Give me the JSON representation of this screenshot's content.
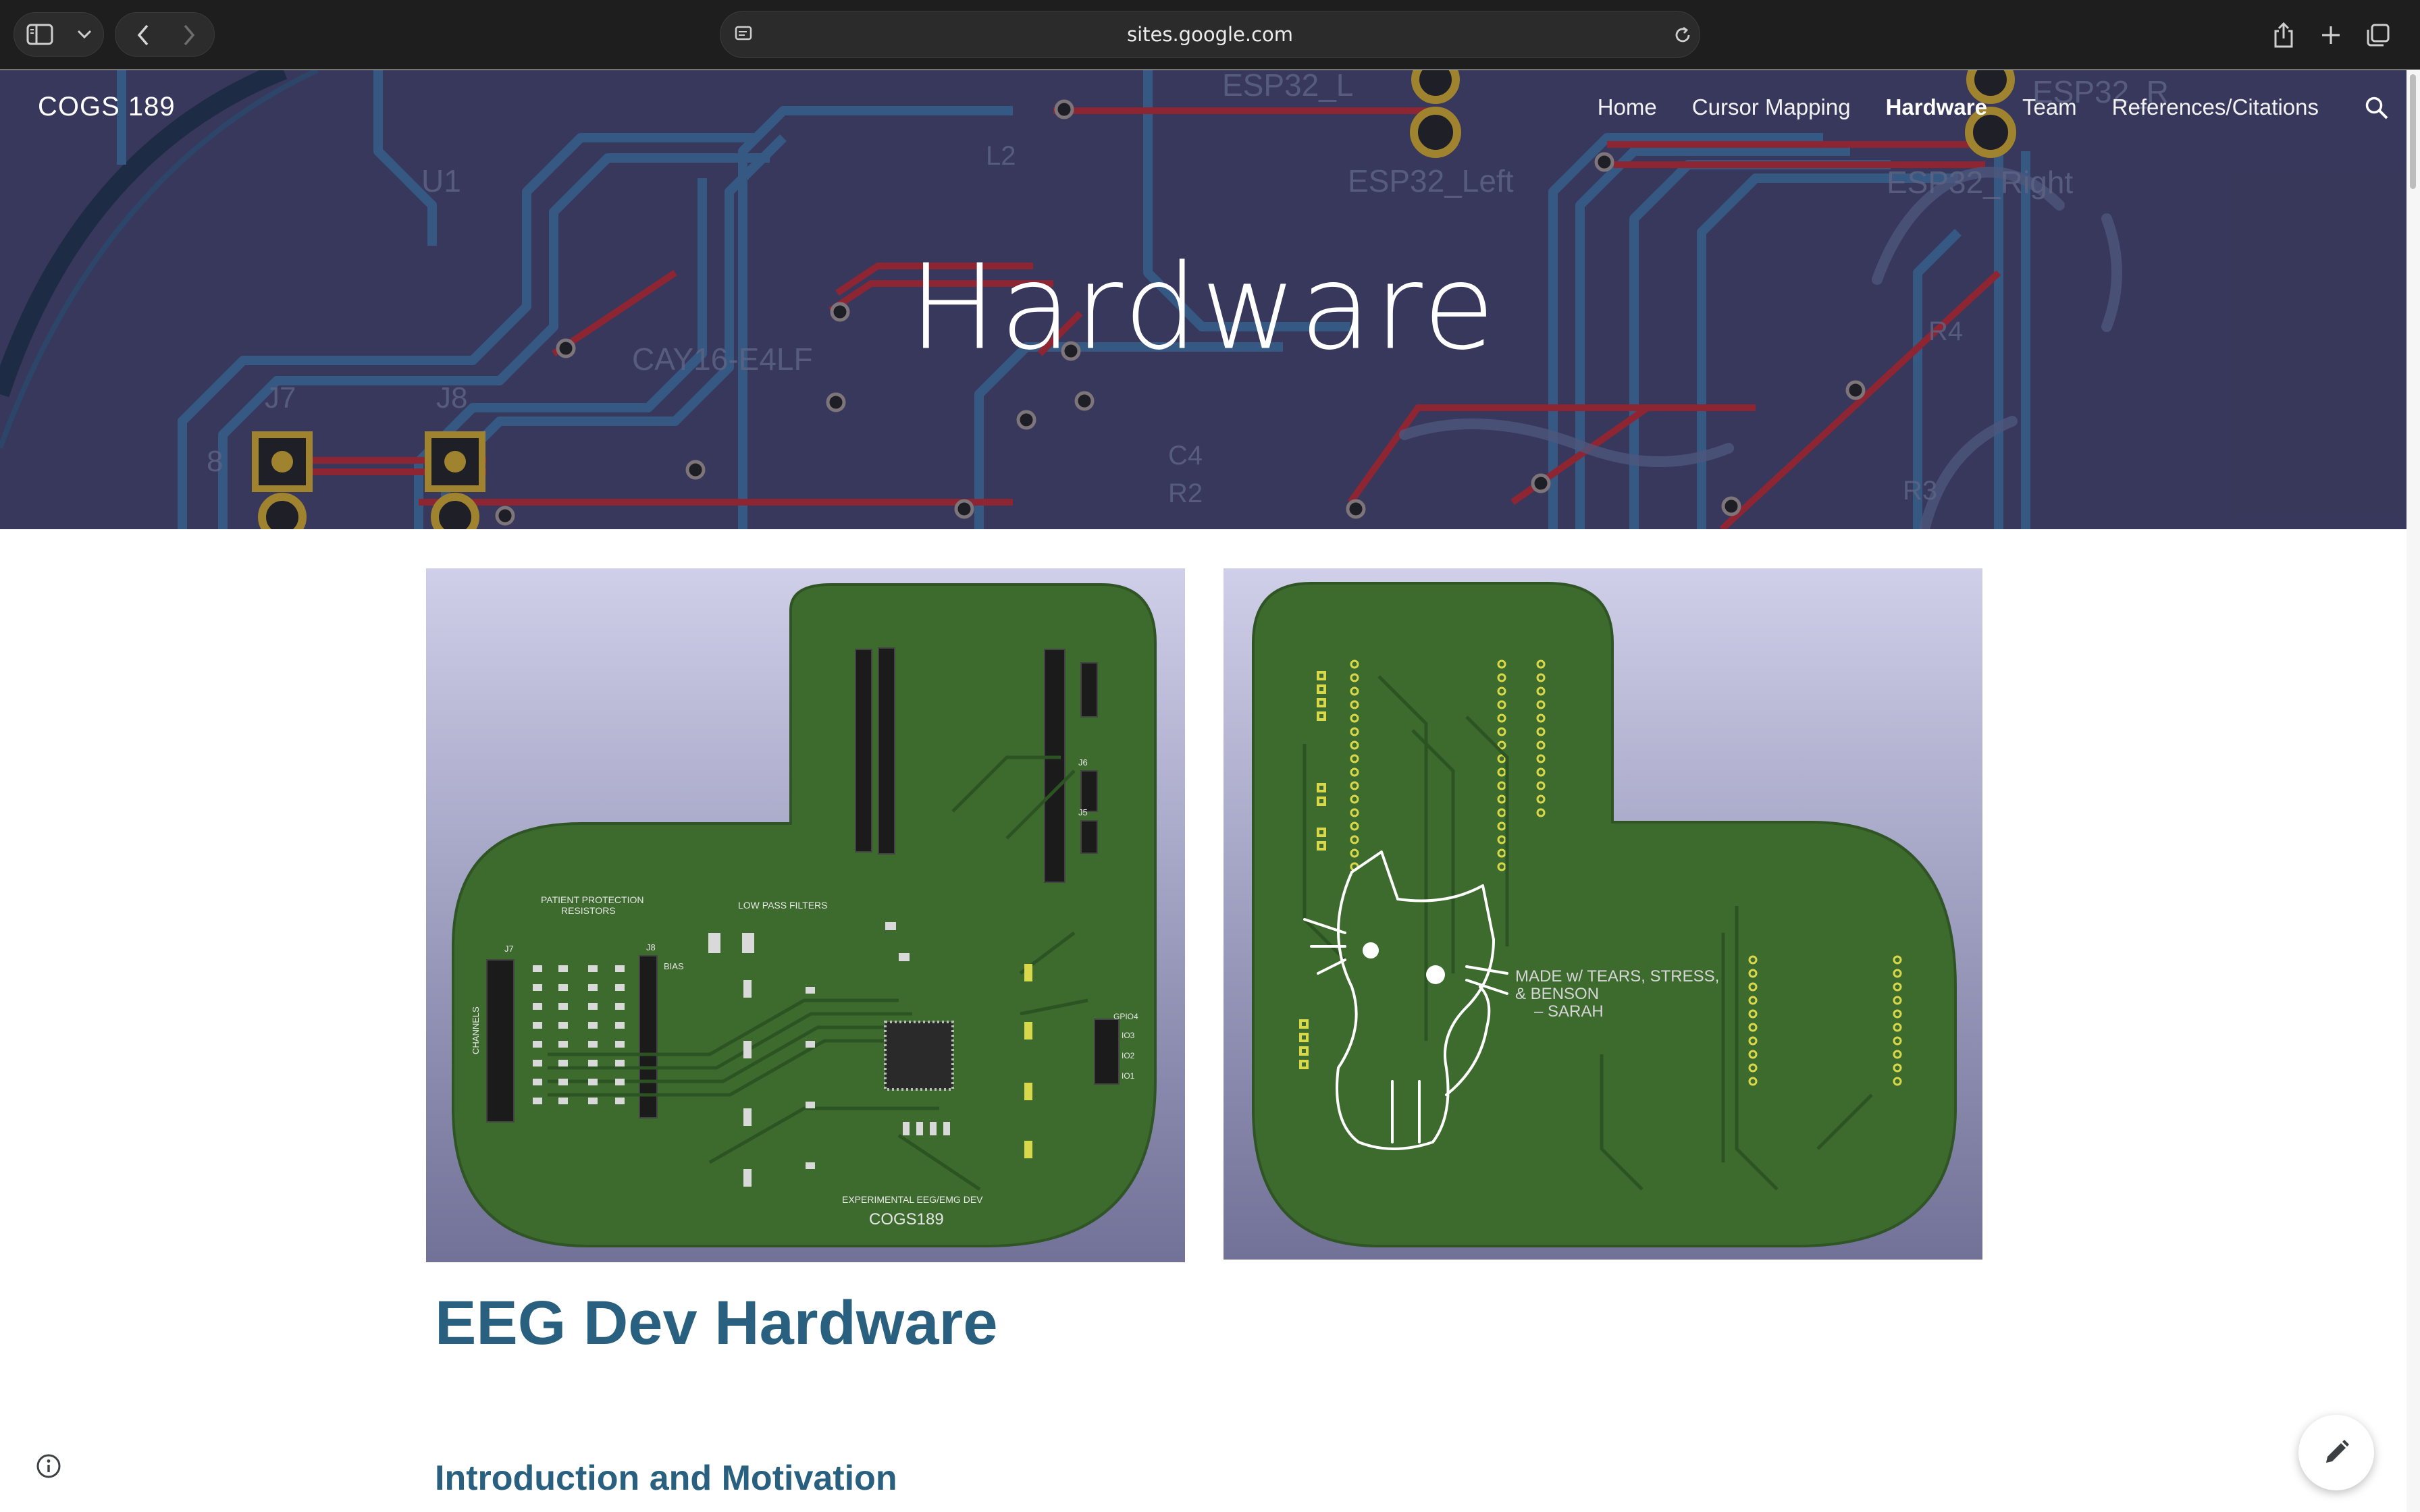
{
  "browser": {
    "url": "sites.google.com",
    "icons": [
      "sidebar-icon",
      "chevron-down-icon",
      "back-icon",
      "forward-icon",
      "page-settings-icon",
      "reload-icon",
      "share-icon",
      "new-tab-icon",
      "tabs-overview-icon"
    ]
  },
  "site": {
    "name": "COGS 189",
    "nav": [
      {
        "label": "Home",
        "active": false
      },
      {
        "label": "Cursor Mapping",
        "active": false
      },
      {
        "label": "Hardware",
        "active": true
      },
      {
        "label": "Team",
        "active": false
      },
      {
        "label": "References/Citations",
        "active": false
      }
    ]
  },
  "hero": {
    "title": "Hardware",
    "pcb_labels": {
      "u1": "U1",
      "j7": "J7",
      "j8": "J8",
      "esp_left": "ESP32_Left",
      "esp_right": "ESP32_Right",
      "esp_l": "ESP32_L",
      "esp_r": "ESP32_R",
      "part": "CAY16-E4LF",
      "c4": "C4",
      "r2": "R2",
      "r4": "R4",
      "r3": "R3",
      "l2": "L2",
      "eight": "8"
    }
  },
  "images": {
    "front": {
      "labels": {
        "patient": "PATIENT PROTECTION",
        "resistors": "RESISTORS",
        "lpf": "LOW PASS FILTERS",
        "footer": "EXPERIMENTAL EEG/EMG DEV",
        "brand": "COGS189",
        "channels": "CHANNELS",
        "j7": "J7",
        "j8": "J8",
        "j5": "J5",
        "j6": "J6",
        "bias": "BIAS",
        "gpio": "GPIO4",
        "io3": "IO3",
        "io2": "IO2",
        "io1": "IO1"
      }
    },
    "back": {
      "signature": [
        "MADE w/ TEARS, STRESS,",
        "& BENSON",
        "– SARAH"
      ]
    }
  },
  "content": {
    "page_heading": "EEG Dev Hardware",
    "section_heading": "Introduction and Motivation"
  },
  "colors": {
    "heading": "#29607f",
    "board_green": "#3d6b2e",
    "trace_blue": "#2f5f8a",
    "trace_red": "#b3242b",
    "pad_gold": "#c9a227"
  }
}
